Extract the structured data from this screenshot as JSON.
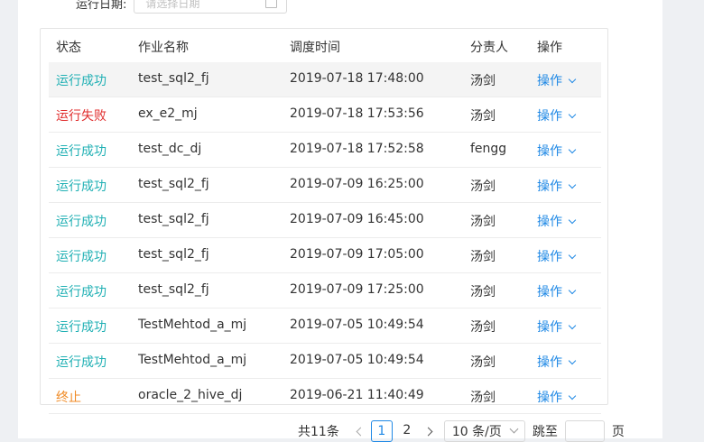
{
  "filter": {
    "label": "运行日期:",
    "date_placeholder": "请选择日期"
  },
  "table": {
    "headers": {
      "status": "状态",
      "name": "作业名称",
      "time": "调度时间",
      "owner": "分责人",
      "op": "操作"
    },
    "rows": [
      {
        "status": "运行成功",
        "status_color": "#20b0b4",
        "name": "test_sql2_fj",
        "time": "2019-07-18 17:48:00",
        "owner": "汤剑",
        "op": "操作"
      },
      {
        "status": "运行失败",
        "status_color": "#e02d2d",
        "name": "ex_e2_mj",
        "time": "2019-07-18 17:53:56",
        "owner": "汤剑",
        "op": "操作"
      },
      {
        "status": "运行成功",
        "status_color": "#20b0b4",
        "name": "test_dc_dj",
        "time": "2019-07-18 17:52:58",
        "owner": "fengg",
        "op": "操作"
      },
      {
        "status": "运行成功",
        "status_color": "#20b0b4",
        "name": "test_sql2_fj",
        "time": "2019-07-09 16:25:00",
        "owner": "汤剑",
        "op": "操作"
      },
      {
        "status": "运行成功",
        "status_color": "#20b0b4",
        "name": "test_sql2_fj",
        "time": "2019-07-09 16:45:00",
        "owner": "汤剑",
        "op": "操作"
      },
      {
        "status": "运行成功",
        "status_color": "#20b0b4",
        "name": "test_sql2_fj",
        "time": "2019-07-09 17:05:00",
        "owner": "汤剑",
        "op": "操作"
      },
      {
        "status": "运行成功",
        "status_color": "#20b0b4",
        "name": "test_sql2_fj",
        "time": "2019-07-09 17:25:00",
        "owner": "汤剑",
        "op": "操作"
      },
      {
        "status": "运行成功",
        "status_color": "#20b0b4",
        "name": "TestMehtod_a_mj",
        "time": "2019-07-05 10:49:54",
        "owner": "汤剑",
        "op": "操作"
      },
      {
        "status": "运行成功",
        "status_color": "#20b0b4",
        "name": "TestMehtod_a_mj",
        "time": "2019-07-05 10:49:54",
        "owner": "汤剑",
        "op": "操作"
      },
      {
        "status": "终止",
        "status_color": "#f08a24",
        "name": "oracle_2_hive_dj",
        "time": "2019-06-21 11:40:49",
        "owner": "汤剑",
        "op": "操作"
      }
    ]
  },
  "pagination": {
    "total": "共11条",
    "pages": [
      "1",
      "2"
    ],
    "current": "1",
    "page_size": "10 条/页",
    "jump_label": "跳至",
    "page_suffix": "页"
  },
  "colors": {
    "accent": "#1e88e5",
    "success": "#20b0b4",
    "failure": "#e02d2d",
    "terminated": "#f08a24"
  },
  "icons": {
    "calendar": "calendar-icon",
    "op_dropdown": "chevron-down-icon",
    "prev": "chevron-left-icon",
    "next": "chevron-right-icon"
  }
}
